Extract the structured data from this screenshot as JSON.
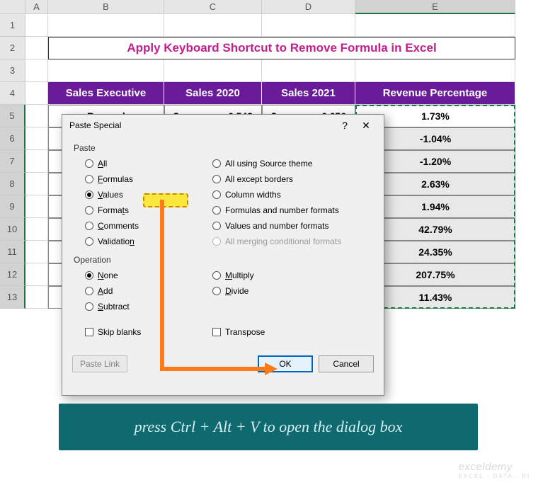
{
  "columns": {
    "A": "A",
    "B": "B",
    "C": "C",
    "D": "D",
    "E": "E"
  },
  "rows": [
    "1",
    "2",
    "3",
    "4",
    "5",
    "6",
    "7",
    "8",
    "9",
    "10",
    "11",
    "12",
    "13"
  ],
  "title": "Apply Keyboard Shortcut to Remove Formula in Excel",
  "headers": {
    "b": "Sales Executive",
    "c": "Sales 2020",
    "d": "Sales 2021",
    "e": "Revenue Percentage"
  },
  "row5": {
    "name": "Bernard",
    "c_sym": "$",
    "c_val": "6,543",
    "d_sym": "$",
    "d_val": "6,656",
    "pct": "1.73%"
  },
  "pcts": [
    "-1.04%",
    "-1.20%",
    "2.63%",
    "1.94%",
    "42.79%",
    "24.35%",
    "207.75%",
    "11.43%"
  ],
  "dialog": {
    "title": "Paste Special",
    "help": "?",
    "paste_lbl": "Paste",
    "op_lbl": "Operation",
    "paste_left": [
      {
        "u": "A",
        "rest": "ll",
        "sel": false
      },
      {
        "u": "F",
        "rest": "ormulas",
        "sel": false
      },
      {
        "u": "V",
        "rest": "alues",
        "sel": true
      },
      {
        "pre": "Forma",
        "u": "t",
        "rest": "s",
        "sel": false
      },
      {
        "u": "C",
        "rest": "omments",
        "sel": false
      },
      {
        "pre": "Validatio",
        "u": "n",
        "rest": "",
        "sel": false
      }
    ],
    "paste_right": [
      {
        "txt": "All using Source theme"
      },
      {
        "txt": "All except borders"
      },
      {
        "txt": "Column widths"
      },
      {
        "txt": "Formulas and number formats"
      },
      {
        "txt": "Values and number formats"
      },
      {
        "txt": "All merging conditional formats",
        "dis": true
      }
    ],
    "op_left": [
      {
        "u": "N",
        "rest": "one",
        "sel": true
      },
      {
        "u": "A",
        "rest": "dd"
      },
      {
        "u": "S",
        "rest": "ubtract"
      }
    ],
    "op_right": [
      {
        "u": "M",
        "rest": "ultiply"
      },
      {
        "u": "D",
        "rest": "ivide"
      }
    ],
    "skip": "Skip blanks",
    "transpose": "Transpose",
    "paste_link": "Paste Link",
    "ok": "OK",
    "cancel": "Cancel"
  },
  "banner": "press Ctrl + Alt + V to open the dialog box",
  "watermark": "exceldemy",
  "watermark_sub": "EXCEL · DATA · BI"
}
